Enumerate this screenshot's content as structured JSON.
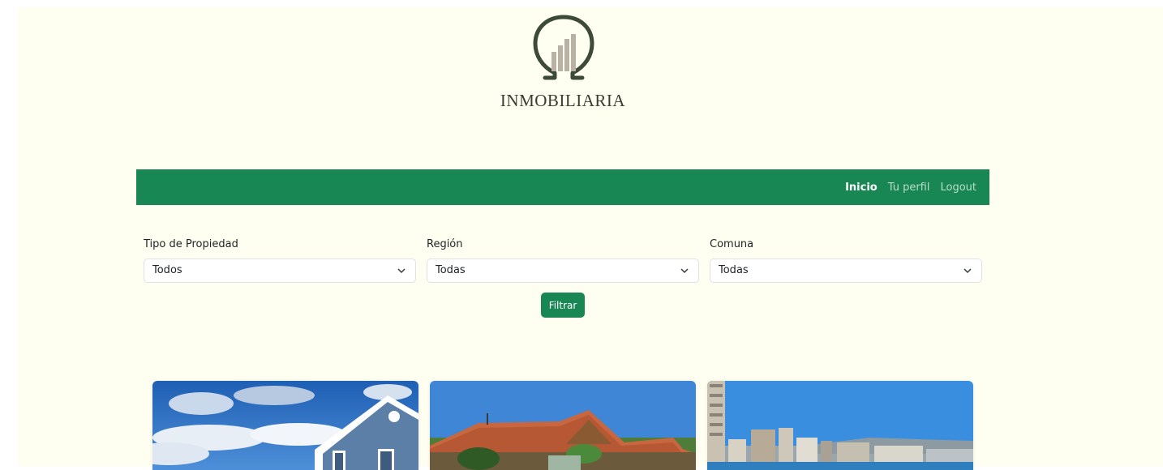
{
  "header": {
    "brand": "INMOBILIARIA",
    "logo_icon": "omega-building-logo"
  },
  "navbar": {
    "links": [
      {
        "label": "Inicio",
        "active": true
      },
      {
        "label": "Tu perfil",
        "active": false
      },
      {
        "label": "Logout",
        "active": false
      }
    ],
    "color": "#198754"
  },
  "filters": {
    "tipo": {
      "label": "Tipo de Propiedad",
      "value": "Todos"
    },
    "region": {
      "label": "Región",
      "value": "Todas"
    },
    "comuna": {
      "label": "Comuna",
      "value": "Todas"
    },
    "submit_label": "Filtrar"
  },
  "properties": [
    {
      "image": "blue-house-sky"
    },
    {
      "image": "tiled-roof-house"
    },
    {
      "image": "coastal-city-skyline"
    }
  ],
  "colors": {
    "background": "#fefff0",
    "accent": "#198754"
  }
}
